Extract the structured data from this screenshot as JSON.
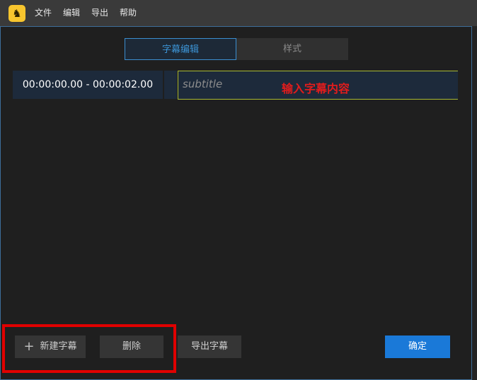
{
  "menubar": {
    "logo_glyph": "♞",
    "items": [
      "文件",
      "编辑",
      "导出",
      "帮助"
    ]
  },
  "tabs": [
    "字幕编辑",
    "样式"
  ],
  "subtitle_row": {
    "time_range": "00:00:00.00 - 00:00:02.00",
    "placeholder": "subtitle",
    "annotation": "输入字幕内容"
  },
  "buttons": {
    "new_subtitle": "新建字幕",
    "delete": "删除",
    "export_subtitle": "导出字幕",
    "confirm": "确定"
  },
  "colors": {
    "accent": "#1a79d8",
    "annotation_red": "#e00000",
    "logo_yellow": "#f7c52e"
  }
}
